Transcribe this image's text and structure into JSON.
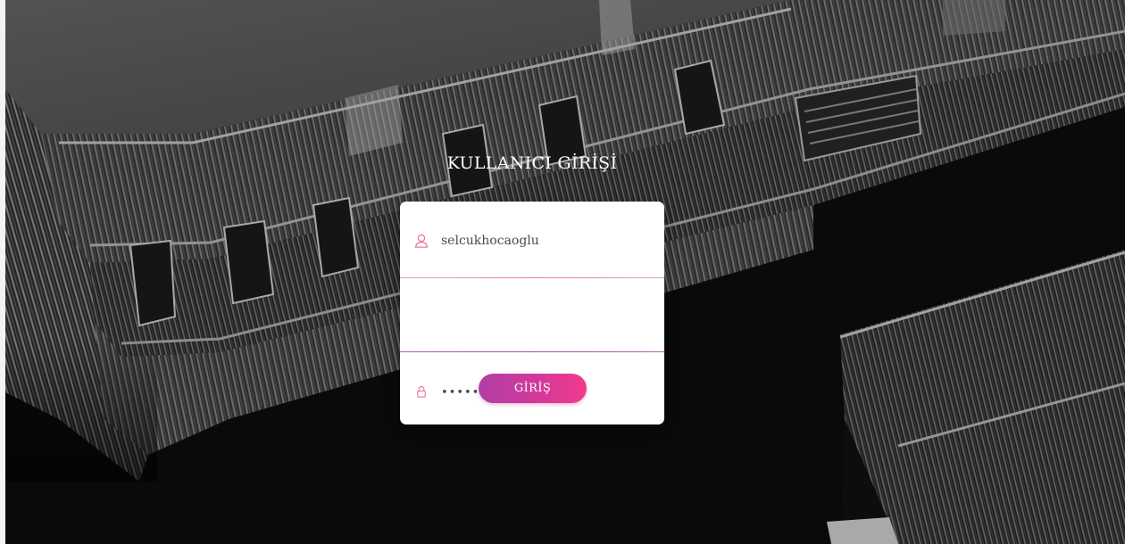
{
  "page": {
    "title": "KULLANICI GİRİŞİ"
  },
  "login_form": {
    "username": {
      "value": "selcukhocaoglu",
      "icon": "user-icon"
    },
    "password": {
      "value": "••••••••••••••••",
      "icon": "lock-icon"
    },
    "submit_label": "GİRİŞ"
  },
  "colors": {
    "accent_start": "#b13fa5",
    "accent_end": "#f23a8c",
    "icon": "#e8768f",
    "card_bg": "#ffffff",
    "title_text": "#ffffff"
  }
}
